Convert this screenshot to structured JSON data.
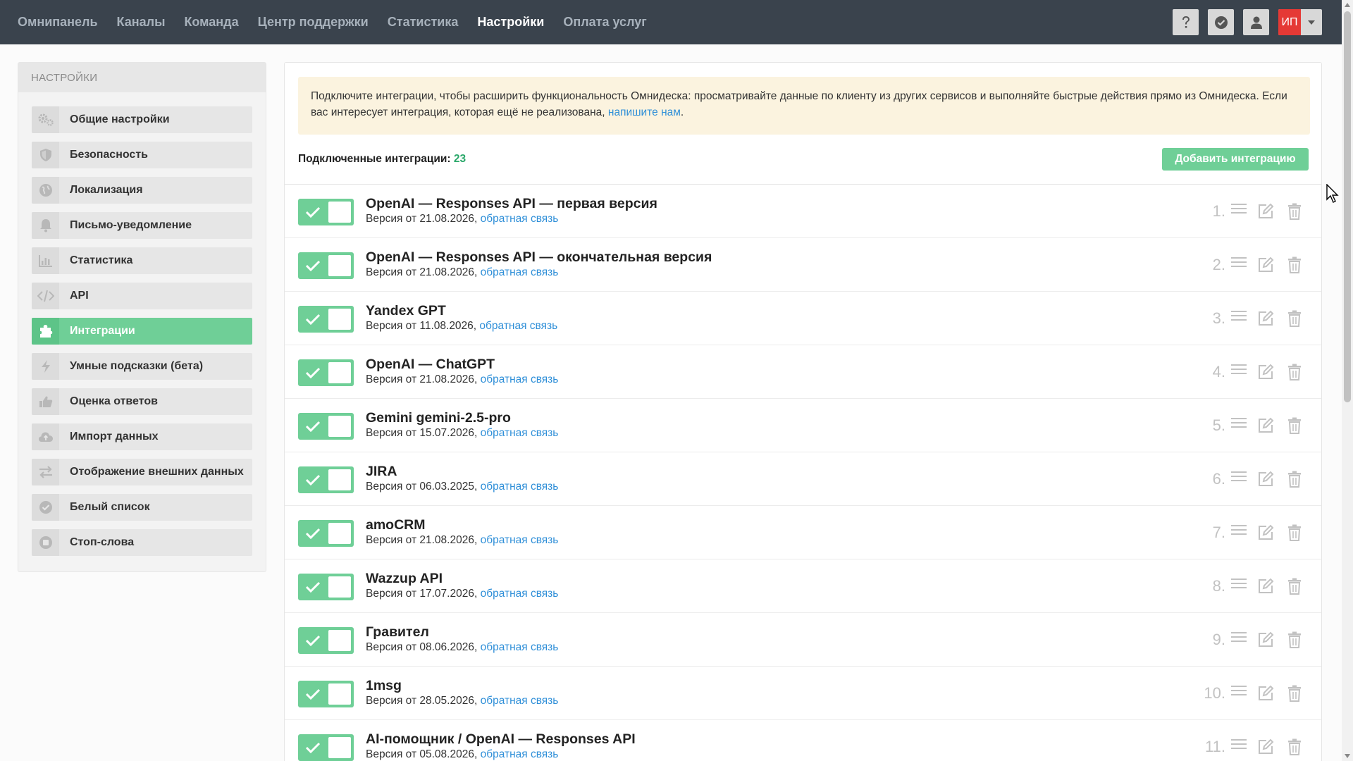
{
  "nav": {
    "items": [
      {
        "label": "Омнипанель"
      },
      {
        "label": "Каналы"
      },
      {
        "label": "Команда"
      },
      {
        "label": "Центр поддержки"
      },
      {
        "label": "Статистика"
      },
      {
        "label": "Настройки",
        "active": true
      },
      {
        "label": "Оплата услуг"
      }
    ],
    "user_initials": "ИП",
    "icons": [
      "question-icon",
      "check-badge-icon",
      "user-icon",
      "chevron-down-icon"
    ]
  },
  "sidebar": {
    "title": "НАСТРОЙКИ",
    "items": [
      {
        "label": "Общие настройки",
        "icon": "gears-icon"
      },
      {
        "label": "Безопасность",
        "icon": "shield-icon"
      },
      {
        "label": "Локализация",
        "icon": "globe-icon"
      },
      {
        "label": "Письмо-уведомление",
        "icon": "bell-icon"
      },
      {
        "label": "Статистика",
        "icon": "bar-chart-icon"
      },
      {
        "label": "API",
        "icon": "code-icon"
      },
      {
        "label": "Интеграции",
        "icon": "puzzle-icon",
        "active": true
      },
      {
        "label": "Умные подсказки (бета)",
        "icon": "bolt-icon"
      },
      {
        "label": "Оценка ответов",
        "icon": "thumbs-up-icon"
      },
      {
        "label": "Импорт данных",
        "icon": "cloud-upload-icon"
      },
      {
        "label": "Отображение внешних данных",
        "icon": "exchange-icon"
      },
      {
        "label": "Белый список",
        "icon": "check-circle-icon"
      },
      {
        "label": "Стоп-слова",
        "icon": "stop-icon"
      }
    ]
  },
  "main": {
    "notice_text": "Подключите интеграции, чтобы расширить функциональность Омнидеска: просматривайте данные по клиенту из других сервисов и выполняйте быстрые действия прямо из Омнидеска. Если вас интересует интеграция, которая ещё не реализована, ",
    "notice_link": "напишите нам",
    "notice_end": ".",
    "connected_label": "Подключенные интеграции:",
    "connected_count": "23",
    "add_button": "Добавить интеграцию"
  },
  "integrations": [
    {
      "num": "1.",
      "title": "OpenAI — Responses API — первая версия",
      "version": "Версия от 21.08.2026,",
      "link": "обратная связь",
      "enabled": true
    },
    {
      "num": "2.",
      "title": "OpenAI — Responses API — окончательная версия",
      "version": "Версия от 21.08.2026,",
      "link": "обратная связь",
      "enabled": true
    },
    {
      "num": "3.",
      "title": "Yandex GPT",
      "version": "Версия от 11.08.2026,",
      "link": "обратная связь",
      "enabled": true
    },
    {
      "num": "4.",
      "title": "OpenAI — ChatGPT",
      "version": "Версия от 21.08.2026,",
      "link": "обратная связь",
      "enabled": true
    },
    {
      "num": "5.",
      "title": "Gemini gemini-2.5-pro",
      "version": "Версия от 15.07.2026,",
      "link": "обратная связь",
      "enabled": true
    },
    {
      "num": "6.",
      "title": "JIRA",
      "version": "Версия от 06.03.2025,",
      "link": "обратная связь",
      "enabled": true
    },
    {
      "num": "7.",
      "title": "amoCRM",
      "version": "Версия от 21.08.2026,",
      "link": "обратная связь",
      "enabled": true
    },
    {
      "num": "8.",
      "title": "Wazzup API",
      "version": "Версия от 17.07.2026,",
      "link": "обратная связь",
      "enabled": true
    },
    {
      "num": "9.",
      "title": "Гравител",
      "version": "Версия от 08.06.2026,",
      "link": "обратная связь",
      "enabled": true
    },
    {
      "num": "10.",
      "title": "1msg",
      "version": "Версия от 28.05.2026,",
      "link": "обратная связь",
      "enabled": true
    },
    {
      "num": "11.",
      "title": "AI-помощник / OpenAI — Responses API",
      "version": "Версия от 05.08.2026,",
      "link": "обратная связь",
      "enabled": true
    }
  ],
  "colors": {
    "accent": "#6fcf97",
    "topbar": "#3a434d",
    "link": "#2f8fd8",
    "notice_bg": "#fbf3df",
    "count": "#2aa86a"
  }
}
